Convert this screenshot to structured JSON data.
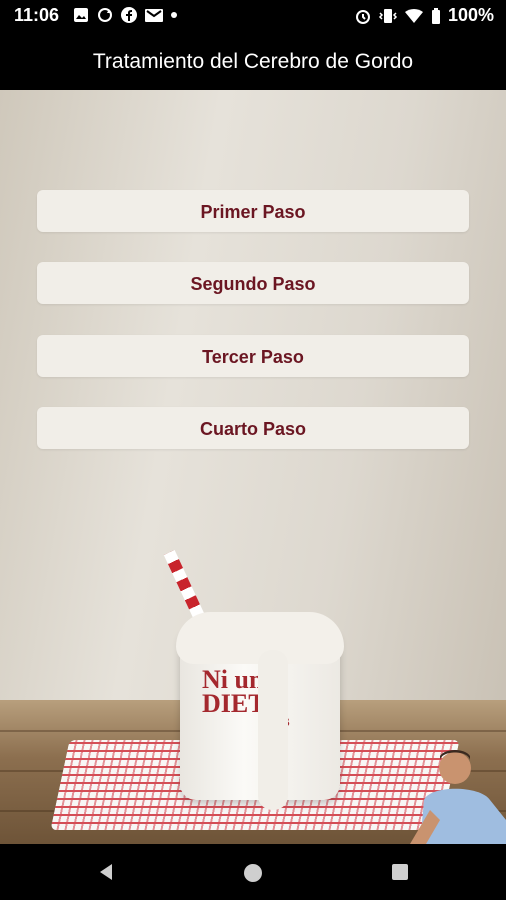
{
  "status_bar": {
    "time": "11:06",
    "battery": "100%",
    "left_icons": [
      "image-icon",
      "sync-icon",
      "facebook-icon",
      "mail-icon",
      "dot-icon"
    ],
    "right_icons": [
      "alarm-icon",
      "vibrate-icon",
      "wifi-icon",
      "battery-icon"
    ]
  },
  "app_bar": {
    "title": "Tratamiento del Cerebro de Gordo"
  },
  "buttons": [
    {
      "label": "Primer Paso"
    },
    {
      "label": "Segundo Paso"
    },
    {
      "label": "Tercer Paso"
    },
    {
      "label": "Cuarto Paso"
    }
  ],
  "background": {
    "logo_line1": "Ni un",
    "logo_line2": "DIETA",
    "logo_line3": "más"
  },
  "nav_bar": {
    "items": [
      "back-icon",
      "home-icon",
      "recents-icon"
    ]
  },
  "colors": {
    "button_text": "#6b1622",
    "button_bg": "#f1eee8",
    "bar_bg": "#000000"
  }
}
